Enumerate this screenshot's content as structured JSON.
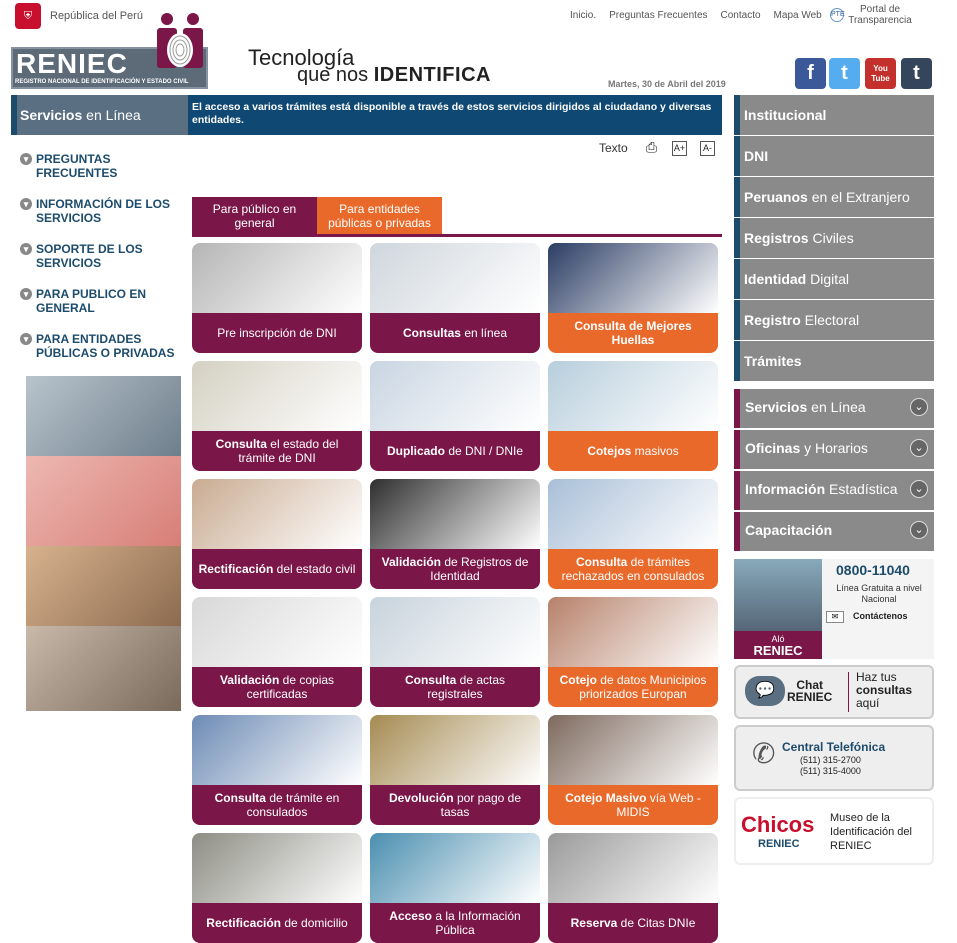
{
  "header": {
    "gov_label": "República del Perú",
    "links": [
      "Inicio.",
      "Preguntas Frecuentes",
      "Contacto",
      "Mapa Web"
    ],
    "portal": "Portal de Transparencia",
    "logo": "RENIEC",
    "logo_sub": "REGISTRO NACIONAL DE IDENTIFICACIÓN Y ESTADO CIVIL",
    "tagline_1": "Tecnología",
    "tagline_2a": "que nos",
    "tagline_2b": "IDENTIFICA",
    "date": "Martes, 30 de Abril del 2019",
    "social": [
      {
        "icon": "facebook-icon",
        "glyph": "f",
        "color": "#3b5998"
      },
      {
        "icon": "twitter-icon",
        "glyph": "t",
        "color": "#55acee"
      },
      {
        "icon": "youtube-icon",
        "glyph": "You Tube",
        "color": "#c4302b"
      },
      {
        "icon": "tumblr-icon",
        "glyph": "t",
        "color": "#35465c"
      }
    ]
  },
  "left": {
    "title_b": "Servicios",
    "title_r": " en Línea",
    "items": [
      "PREGUNTAS FRECUENTES",
      "INFORMACIÓN DE LOS SERVICIOS",
      "SOPORTE DE LOS SERVICIOS",
      "PARA PUBLICO EN GENERAL",
      "PARA ENTIDADES PÚBLICAS O PRIVADAS"
    ]
  },
  "main": {
    "info": "El acceso a varios trámites está disponible a través de estos servicios dirigidos al ciudadano y diversas entidades.",
    "text_label": "Texto",
    "tabs": [
      "Para público en general",
      "Para entidades públicas o privadas"
    ],
    "tiles": [
      {
        "b": "",
        "r": "Pre inscripción de DNI",
        "color": "#7a1648",
        "img": "#b5b5b5"
      },
      {
        "b": "Consultas",
        "r": " en línea",
        "color": "#7a1648",
        "img": "#cfd6dd"
      },
      {
        "b": "Consulta de Mejores Huellas",
        "r": "",
        "color": "#e9692b",
        "img": "#2b3d64"
      },
      {
        "b": "Consulta",
        "r": " el estado del trámite de DNI",
        "color": "#7a1648",
        "img": "#d4d0c2"
      },
      {
        "b": "Duplicado",
        "r": " de DNI / DNIe",
        "color": "#7a1648",
        "img": "#c9d5e2"
      },
      {
        "b": "Cotejos",
        "r": " masivos",
        "color": "#e9692b",
        "img": "#b7cedc"
      },
      {
        "b": "Rectificación",
        "r": " del estado civil",
        "color": "#7a1648",
        "img": "#c9ab91"
      },
      {
        "b": "Validación",
        "r": " de Registros de Identidad",
        "color": "#7a1648",
        "img": "#2f2f2f"
      },
      {
        "b": "Consulta",
        "r": " de trámites rechazados en consulados",
        "color": "#e9692b",
        "img": "#a9bfd8"
      },
      {
        "b": "Validación",
        "r": " de copias certificadas",
        "color": "#7a1648",
        "img": "#d8d8d8"
      },
      {
        "b": "Consulta",
        "r": " de actas registrales",
        "color": "#7a1648",
        "img": "#c8d3dc"
      },
      {
        "b": "Cotejo",
        "r": " de datos Municipios priorizados Europan",
        "color": "#e9692b",
        "img": "#b7816a"
      },
      {
        "b": "Consulta",
        "r": " de trámite en consulados",
        "color": "#7a1648",
        "img": "#6d8bb5"
      },
      {
        "b": "Devolución",
        "r": " por pago de tasas",
        "color": "#7a1648",
        "img": "#a58b52"
      },
      {
        "b": "Cotejo Masivo",
        "r": " vía Web - MIDIS",
        "color": "#e9692b",
        "img": "#7e6a5e"
      },
      {
        "b": "Rectificación",
        "r": " de domicilio",
        "color": "#7a1648",
        "img": "#8d8d84"
      },
      {
        "b": "Acceso",
        "r": " a la Información Pública",
        "color": "#7a1648",
        "img": "#4b8fb0"
      },
      {
        "b": "Reserva",
        "r": " de Citas DNIe",
        "color": "#7a1648",
        "img": "#9a9a9a"
      }
    ]
  },
  "right": {
    "menu": [
      {
        "b": "Institucional",
        "r": ""
      },
      {
        "b": "DNI",
        "r": ""
      },
      {
        "b": "Peruanos",
        "r": " en el Extranjero"
      },
      {
        "b": "Registros",
        "r": " Civiles"
      },
      {
        "b": "Identidad",
        "r": " Digital"
      },
      {
        "b": "Registro",
        "r": " Electoral"
      },
      {
        "b": "Trámites",
        "r": ""
      }
    ],
    "menu2": [
      {
        "b": "Servicios",
        "r": " en Línea"
      },
      {
        "b": "Oficinas",
        "r": " y Horarios"
      },
      {
        "b": "Información",
        "r": " Estadística"
      },
      {
        "b": "Capacitación",
        "r": ""
      }
    ],
    "alo_1": "Aló",
    "alo_2": "RENIEC",
    "phone": "0800-11040",
    "linea": "Línea Gratuita a nivel Nacional",
    "contact": "Contáctenos",
    "chat_1": "Chat",
    "chat_2": "RENIEC",
    "chat_t1": "Haz tus",
    "chat_t2": "consultas",
    "chat_t3": "aquí",
    "central": "Central Telefónica",
    "tel1": "(511) 315-2700",
    "tel2": "(511) 315-4000",
    "chicos": "Chicos",
    "chicos_sub": "RENIEC",
    "museo": "Museo de la Identificación del RENIEC"
  }
}
